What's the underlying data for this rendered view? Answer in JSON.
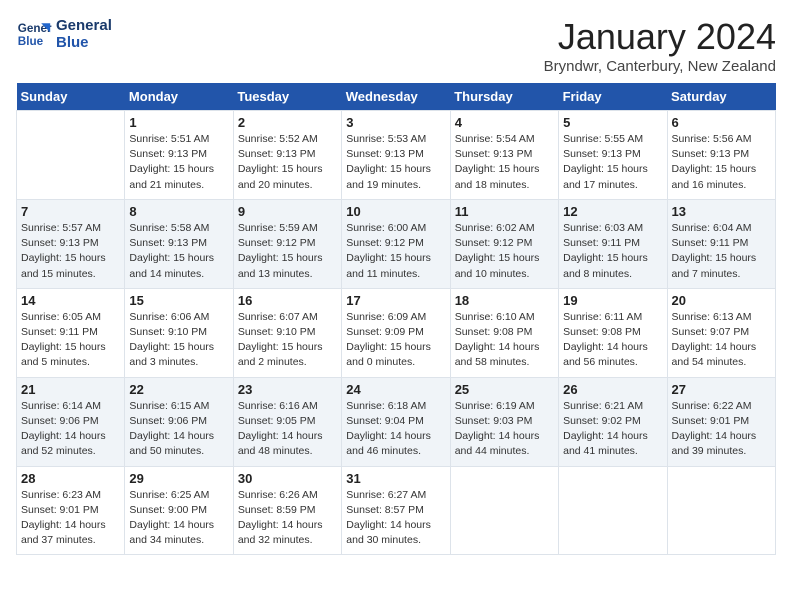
{
  "logo": {
    "line1": "General",
    "line2": "Blue"
  },
  "title": "January 2024",
  "location": "Bryndwr, Canterbury, New Zealand",
  "weekdays": [
    "Sunday",
    "Monday",
    "Tuesday",
    "Wednesday",
    "Thursday",
    "Friday",
    "Saturday"
  ],
  "weeks": [
    [
      {
        "day": "",
        "info": ""
      },
      {
        "day": "1",
        "info": "Sunrise: 5:51 AM\nSunset: 9:13 PM\nDaylight: 15 hours\nand 21 minutes."
      },
      {
        "day": "2",
        "info": "Sunrise: 5:52 AM\nSunset: 9:13 PM\nDaylight: 15 hours\nand 20 minutes."
      },
      {
        "day": "3",
        "info": "Sunrise: 5:53 AM\nSunset: 9:13 PM\nDaylight: 15 hours\nand 19 minutes."
      },
      {
        "day": "4",
        "info": "Sunrise: 5:54 AM\nSunset: 9:13 PM\nDaylight: 15 hours\nand 18 minutes."
      },
      {
        "day": "5",
        "info": "Sunrise: 5:55 AM\nSunset: 9:13 PM\nDaylight: 15 hours\nand 17 minutes."
      },
      {
        "day": "6",
        "info": "Sunrise: 5:56 AM\nSunset: 9:13 PM\nDaylight: 15 hours\nand 16 minutes."
      }
    ],
    [
      {
        "day": "7",
        "info": "Sunrise: 5:57 AM\nSunset: 9:13 PM\nDaylight: 15 hours\nand 15 minutes."
      },
      {
        "day": "8",
        "info": "Sunrise: 5:58 AM\nSunset: 9:13 PM\nDaylight: 15 hours\nand 14 minutes."
      },
      {
        "day": "9",
        "info": "Sunrise: 5:59 AM\nSunset: 9:12 PM\nDaylight: 15 hours\nand 13 minutes."
      },
      {
        "day": "10",
        "info": "Sunrise: 6:00 AM\nSunset: 9:12 PM\nDaylight: 15 hours\nand 11 minutes."
      },
      {
        "day": "11",
        "info": "Sunrise: 6:02 AM\nSunset: 9:12 PM\nDaylight: 15 hours\nand 10 minutes."
      },
      {
        "day": "12",
        "info": "Sunrise: 6:03 AM\nSunset: 9:11 PM\nDaylight: 15 hours\nand 8 minutes."
      },
      {
        "day": "13",
        "info": "Sunrise: 6:04 AM\nSunset: 9:11 PM\nDaylight: 15 hours\nand 7 minutes."
      }
    ],
    [
      {
        "day": "14",
        "info": "Sunrise: 6:05 AM\nSunset: 9:11 PM\nDaylight: 15 hours\nand 5 minutes."
      },
      {
        "day": "15",
        "info": "Sunrise: 6:06 AM\nSunset: 9:10 PM\nDaylight: 15 hours\nand 3 minutes."
      },
      {
        "day": "16",
        "info": "Sunrise: 6:07 AM\nSunset: 9:10 PM\nDaylight: 15 hours\nand 2 minutes."
      },
      {
        "day": "17",
        "info": "Sunrise: 6:09 AM\nSunset: 9:09 PM\nDaylight: 15 hours\nand 0 minutes."
      },
      {
        "day": "18",
        "info": "Sunrise: 6:10 AM\nSunset: 9:08 PM\nDaylight: 14 hours\nand 58 minutes."
      },
      {
        "day": "19",
        "info": "Sunrise: 6:11 AM\nSunset: 9:08 PM\nDaylight: 14 hours\nand 56 minutes."
      },
      {
        "day": "20",
        "info": "Sunrise: 6:13 AM\nSunset: 9:07 PM\nDaylight: 14 hours\nand 54 minutes."
      }
    ],
    [
      {
        "day": "21",
        "info": "Sunrise: 6:14 AM\nSunset: 9:06 PM\nDaylight: 14 hours\nand 52 minutes."
      },
      {
        "day": "22",
        "info": "Sunrise: 6:15 AM\nSunset: 9:06 PM\nDaylight: 14 hours\nand 50 minutes."
      },
      {
        "day": "23",
        "info": "Sunrise: 6:16 AM\nSunset: 9:05 PM\nDaylight: 14 hours\nand 48 minutes."
      },
      {
        "day": "24",
        "info": "Sunrise: 6:18 AM\nSunset: 9:04 PM\nDaylight: 14 hours\nand 46 minutes."
      },
      {
        "day": "25",
        "info": "Sunrise: 6:19 AM\nSunset: 9:03 PM\nDaylight: 14 hours\nand 44 minutes."
      },
      {
        "day": "26",
        "info": "Sunrise: 6:21 AM\nSunset: 9:02 PM\nDaylight: 14 hours\nand 41 minutes."
      },
      {
        "day": "27",
        "info": "Sunrise: 6:22 AM\nSunset: 9:01 PM\nDaylight: 14 hours\nand 39 minutes."
      }
    ],
    [
      {
        "day": "28",
        "info": "Sunrise: 6:23 AM\nSunset: 9:01 PM\nDaylight: 14 hours\nand 37 minutes."
      },
      {
        "day": "29",
        "info": "Sunrise: 6:25 AM\nSunset: 9:00 PM\nDaylight: 14 hours\nand 34 minutes."
      },
      {
        "day": "30",
        "info": "Sunrise: 6:26 AM\nSunset: 8:59 PM\nDaylight: 14 hours\nand 32 minutes."
      },
      {
        "day": "31",
        "info": "Sunrise: 6:27 AM\nSunset: 8:57 PM\nDaylight: 14 hours\nand 30 minutes."
      },
      {
        "day": "",
        "info": ""
      },
      {
        "day": "",
        "info": ""
      },
      {
        "day": "",
        "info": ""
      }
    ]
  ]
}
